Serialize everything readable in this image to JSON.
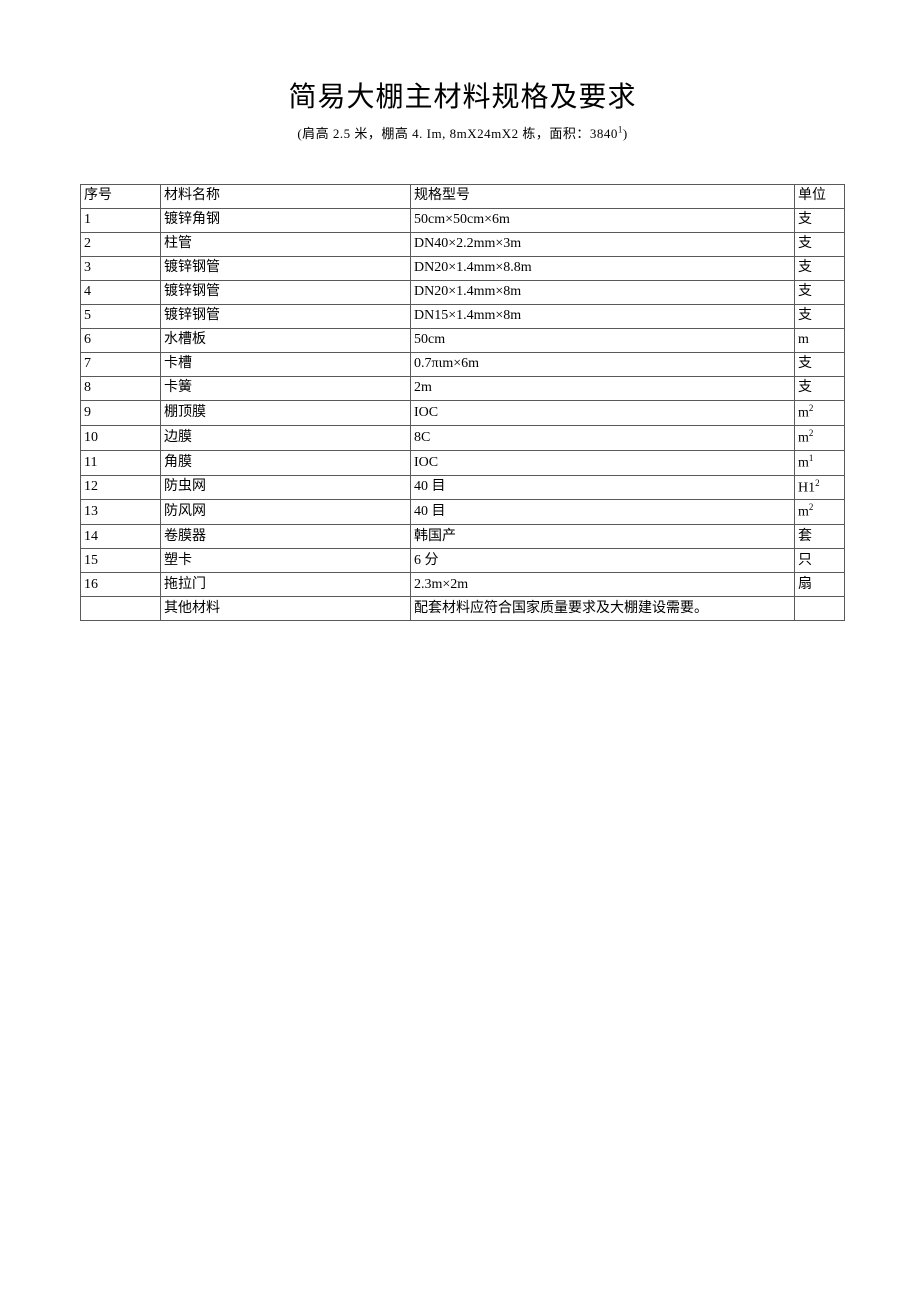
{
  "title": "简易大棚主材料规格及要求",
  "subtitle_prefix": "(肩高 2.5 米，棚高 4. Im, 8mX24mX2 栋，面积：3840",
  "subtitle_sup": "1",
  "subtitle_suffix": ")",
  "headers": {
    "seq": "序号",
    "name": "材料名称",
    "spec": "规格型号",
    "unit": "单位"
  },
  "rows": [
    {
      "seq": "1",
      "name": "镀锌角钢",
      "spec": "50cm×50cm×6m",
      "unit": "支"
    },
    {
      "seq": "2",
      "name": "柱管",
      "spec": "DN40×2.2mm×3m",
      "unit": "支"
    },
    {
      "seq": "3",
      "name": "镀锌钢管",
      "spec": "DN20×1.4mm×8.8m",
      "unit": "支"
    },
    {
      "seq": "4",
      "name": "镀锌钢管",
      "spec": "DN20×1.4mm×8m",
      "unit": "支"
    },
    {
      "seq": "5",
      "name": "镀锌钢管",
      "spec": "DN15×1.4mm×8m",
      "unit": "支"
    },
    {
      "seq": "6",
      "name": "水槽板",
      "spec": "50cm",
      "unit": "m"
    },
    {
      "seq": "7",
      "name": "卡槽",
      "spec": "0.7πιm×6m",
      "unit": "支"
    },
    {
      "seq": "8",
      "name": "卡簧",
      "spec": "2m",
      "unit": "支"
    },
    {
      "seq": "9",
      "name": "棚顶膜",
      "spec": "IOC",
      "unit_base": "m",
      "unit_sup": "2"
    },
    {
      "seq": "10",
      "name": "边膜",
      "spec": "8C",
      "unit_base": "m",
      "unit_sup": "2"
    },
    {
      "seq": "11",
      "name": "角膜",
      "spec": "IOC",
      "unit_base": "m",
      "unit_sup": "1"
    },
    {
      "seq": "12",
      "name": "防虫网",
      "spec": "40 目",
      "unit_base": "H1",
      "unit_sup": "2"
    },
    {
      "seq": "13",
      "name": "防风网",
      "spec": "40 目",
      "unit_base": "m",
      "unit_sup": "2"
    },
    {
      "seq": "14",
      "name": "卷膜器",
      "spec": "韩国产",
      "unit": "套"
    },
    {
      "seq": "15",
      "name": "塑卡",
      "spec": "6 分",
      "unit": "只"
    },
    {
      "seq": "16",
      "name": "拖拉门",
      "spec": "2.3m×2m",
      "unit": "扇"
    },
    {
      "seq": "",
      "name": "其他材料",
      "spec": "配套材料应符合国家质量要求及大棚建设需要。",
      "unit": ""
    }
  ]
}
